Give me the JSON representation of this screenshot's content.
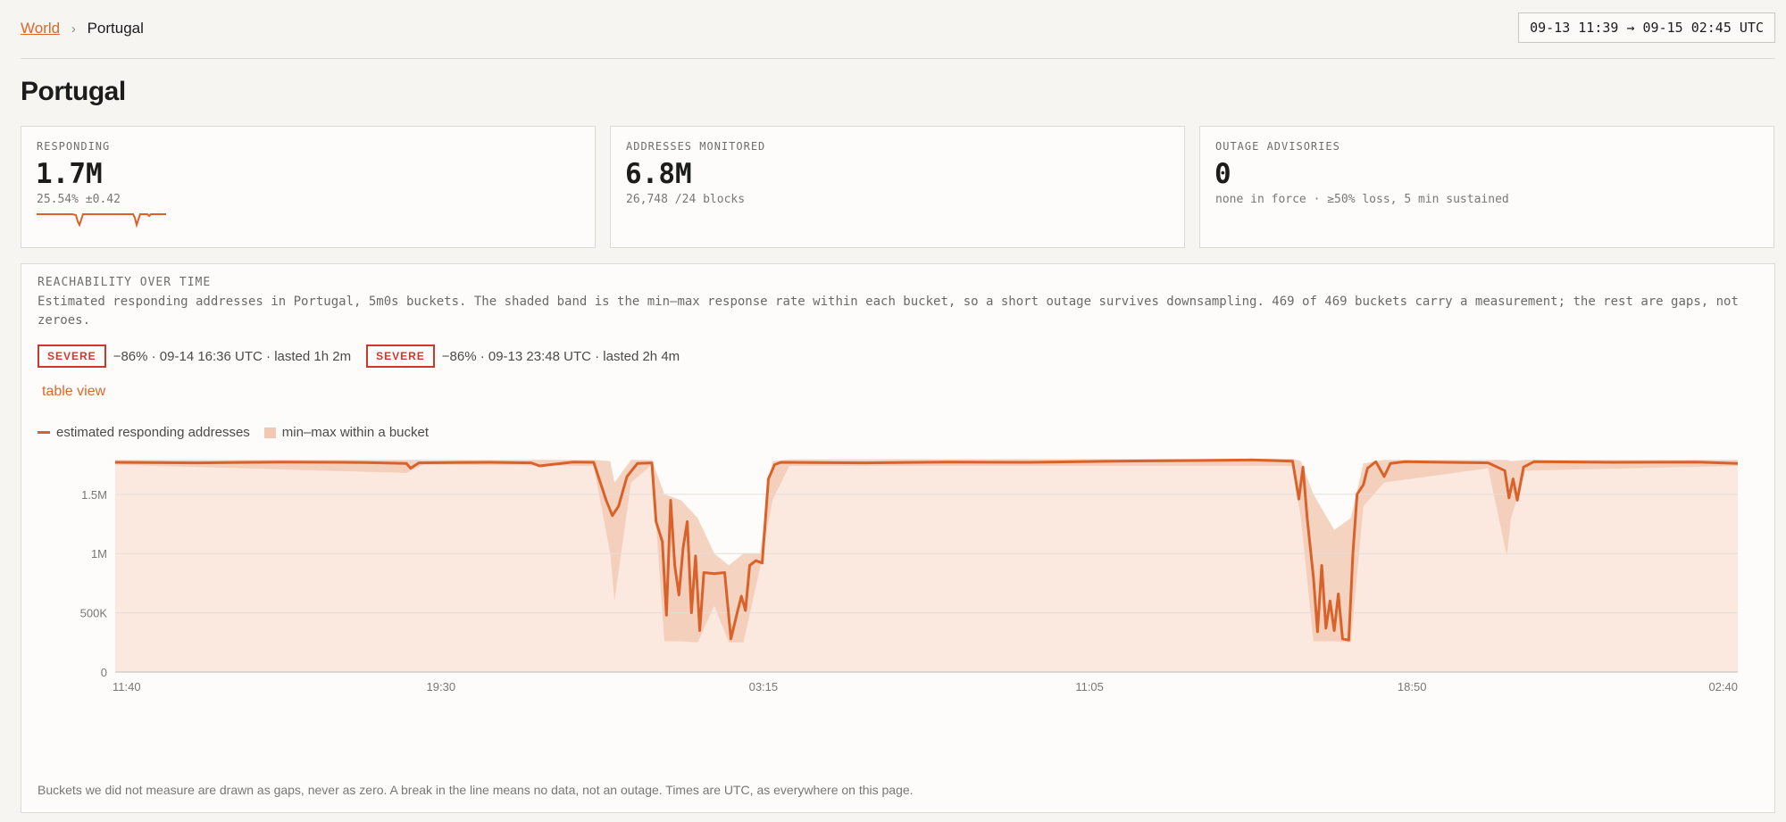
{
  "breadcrumb": {
    "root": "World",
    "separator": "›",
    "current": "Portugal"
  },
  "time_range": "09-13 11:39 → 09-15 02:45 UTC",
  "page_title": "Portugal",
  "cards": [
    {
      "label": "RESPONDING",
      "value": "1.7M",
      "sub": "25.54% ±0.42"
    },
    {
      "label": "ADDRESSES MONITORED",
      "value": "6.8M",
      "sub": "26,748 /24 blocks"
    },
    {
      "label": "OUTAGE ADVISORIES",
      "value": "0",
      "sub": "none in force · ≥50% loss, 5 min sustained"
    }
  ],
  "panel": {
    "title": "REACHABILITY OVER TIME",
    "description": "Estimated responding addresses in Portugal, 5m0s buckets. The shaded band is the min–max response rate within each bucket, so a short outage survives downsampling. 469 of 469 buckets carry a measurement; the rest are gaps, not zeroes.",
    "events": [
      {
        "badge": "SEVERE",
        "text": "−86% · 09-14 16:36 UTC · lasted 1h 2m"
      },
      {
        "badge": "SEVERE",
        "text": "−86% · 09-13 23:48 UTC · lasted 2h 4m"
      }
    ],
    "table_link": "table view",
    "legend": {
      "line": "estimated responding addresses",
      "band": "min–max within a bucket"
    },
    "footnote": "Buckets we did not measure are drawn as gaps, never as zero. A break in the line means no data, not an outage. Times are UTC, as everywhere on this page."
  },
  "colors": {
    "accent": "#d9622a",
    "band": "#fbe8df",
    "severe": "#c73a2e"
  },
  "chart_data": {
    "type": "area",
    "title": "",
    "xlabel": "",
    "ylabel": "",
    "ylim": [
      0,
      1800000
    ],
    "yticks": [
      {
        "value": 0,
        "label": "0"
      },
      {
        "value": 500000,
        "label": "500K"
      },
      {
        "value": 1000000,
        "label": "1M"
      },
      {
        "value": 1500000,
        "label": "1.5M"
      }
    ],
    "xlim": [
      "09-13 11:40",
      "09-15 02:40"
    ],
    "xticks": [
      {
        "hours": 0,
        "label": "11:40"
      },
      {
        "hours": 7.83,
        "label": "19:30"
      },
      {
        "hours": 15.58,
        "label": "03:15"
      },
      {
        "hours": 23.42,
        "label": "11:05"
      },
      {
        "hours": 31.17,
        "label": "18:50"
      },
      {
        "hours": 39.0,
        "label": "02:40"
      }
    ],
    "grid": true,
    "legend_position": "top-left",
    "series": [
      {
        "name": "estimated responding addresses",
        "points": [
          [
            0,
            1770000
          ],
          [
            2,
            1765000
          ],
          [
            4,
            1772000
          ],
          [
            6,
            1768000
          ],
          [
            7,
            1760000
          ],
          [
            7.1,
            1720000
          ],
          [
            7.3,
            1765000
          ],
          [
            9,
            1770000
          ],
          [
            10,
            1765000
          ],
          [
            10.2,
            1740000
          ],
          [
            11,
            1772000
          ],
          [
            11.5,
            1770000
          ],
          [
            11.8,
            1450000
          ],
          [
            11.95,
            1320000
          ],
          [
            12.1,
            1400000
          ],
          [
            12.3,
            1650000
          ],
          [
            12.55,
            1760000
          ],
          [
            12.9,
            1765000
          ],
          [
            13.0,
            1270000
          ],
          [
            13.15,
            1100000
          ],
          [
            13.25,
            480000
          ],
          [
            13.35,
            1450000
          ],
          [
            13.45,
            900000
          ],
          [
            13.55,
            650000
          ],
          [
            13.65,
            1050000
          ],
          [
            13.75,
            1270000
          ],
          [
            13.85,
            500000
          ],
          [
            13.95,
            980000
          ],
          [
            14.05,
            350000
          ],
          [
            14.15,
            840000
          ],
          [
            14.4,
            830000
          ],
          [
            14.65,
            840000
          ],
          [
            14.8,
            280000
          ],
          [
            14.95,
            500000
          ],
          [
            15.05,
            640000
          ],
          [
            15.15,
            520000
          ],
          [
            15.25,
            900000
          ],
          [
            15.4,
            940000
          ],
          [
            15.55,
            920000
          ],
          [
            15.7,
            1630000
          ],
          [
            15.85,
            1750000
          ],
          [
            16.0,
            1770000
          ],
          [
            18,
            1765000
          ],
          [
            20,
            1772000
          ],
          [
            22,
            1770000
          ],
          [
            24,
            1780000
          ],
          [
            26,
            1785000
          ],
          [
            27.3,
            1790000
          ],
          [
            28.3,
            1780000
          ],
          [
            28.45,
            1460000
          ],
          [
            28.55,
            1730000
          ],
          [
            28.65,
            1300000
          ],
          [
            28.8,
            800000
          ],
          [
            28.9,
            340000
          ],
          [
            29.0,
            900000
          ],
          [
            29.1,
            370000
          ],
          [
            29.2,
            600000
          ],
          [
            29.3,
            350000
          ],
          [
            29.4,
            660000
          ],
          [
            29.5,
            280000
          ],
          [
            29.65,
            270000
          ],
          [
            29.75,
            1000000
          ],
          [
            29.85,
            1500000
          ],
          [
            30.0,
            1580000
          ],
          [
            30.1,
            1720000
          ],
          [
            30.3,
            1775000
          ],
          [
            30.5,
            1650000
          ],
          [
            30.65,
            1760000
          ],
          [
            31.0,
            1775000
          ],
          [
            32.0,
            1770000
          ],
          [
            33.0,
            1765000
          ],
          [
            33.4,
            1700000
          ],
          [
            33.5,
            1470000
          ],
          [
            33.6,
            1630000
          ],
          [
            33.7,
            1450000
          ],
          [
            33.85,
            1730000
          ],
          [
            34.1,
            1775000
          ],
          [
            36,
            1770000
          ],
          [
            38,
            1772000
          ],
          [
            39,
            1760000
          ]
        ]
      },
      {
        "name": "min–max within a bucket",
        "points": [
          [
            0,
            1750000,
            1790000
          ],
          [
            7.0,
            1680000,
            1790000
          ],
          [
            7.4,
            1750000,
            1790000
          ],
          [
            11.5,
            1740000,
            1790000
          ],
          [
            11.9,
            1000000,
            1780000
          ],
          [
            12.0,
            600000,
            1600000
          ],
          [
            12.4,
            1600000,
            1790000
          ],
          [
            12.9,
            1750000,
            1790000
          ],
          [
            13.2,
            260000,
            1500000
          ],
          [
            13.6,
            260000,
            1450000
          ],
          [
            14.0,
            250000,
            1300000
          ],
          [
            14.4,
            560000,
            1000000
          ],
          [
            14.75,
            250000,
            900000
          ],
          [
            15.1,
            250000,
            1000000
          ],
          [
            15.5,
            880000,
            1000000
          ],
          [
            15.8,
            1450000,
            1780000
          ],
          [
            16.2,
            1740000,
            1795000
          ],
          [
            28.3,
            1740000,
            1800000
          ],
          [
            28.5,
            1300000,
            1780000
          ],
          [
            28.8,
            260000,
            1500000
          ],
          [
            29.3,
            260000,
            1200000
          ],
          [
            29.7,
            250000,
            1300000
          ],
          [
            30.0,
            1400000,
            1760000
          ],
          [
            30.5,
            1600000,
            1790000
          ],
          [
            33.0,
            1720000,
            1790000
          ],
          [
            33.45,
            980000,
            1790000
          ],
          [
            33.55,
            1300000,
            1780000
          ],
          [
            33.9,
            1700000,
            1790000
          ],
          [
            39,
            1740000,
            1790000
          ]
        ]
      }
    ]
  }
}
